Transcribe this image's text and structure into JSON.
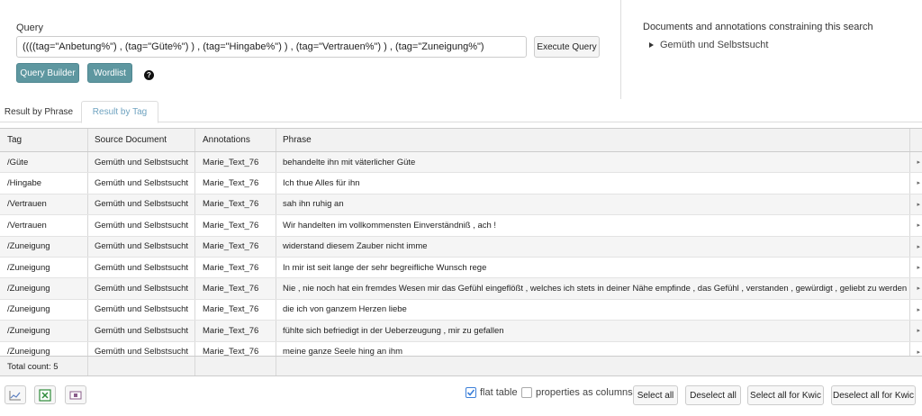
{
  "query": {
    "label": "Query",
    "value": "((((tag=\"Anbetung%\") , (tag=\"Güte%\") ) , (tag=\"Hingabe%\") ) , (tag=\"Vertrauen%\") ) , (tag=\"Zuneigung%\")",
    "execute_label": "Execute Query",
    "query_builder_label": "Query Builder",
    "wordlist_label": "Wordlist"
  },
  "constraints": {
    "title": "Documents and annotations constraining this search",
    "items": [
      "Gemüth und Selbstsucht"
    ]
  },
  "tabs": [
    {
      "label": "Result by Phrase",
      "active": false
    },
    {
      "label": "Result by Tag",
      "active": true
    }
  ],
  "table": {
    "columns": [
      "Tag",
      "Source Document",
      "Annotations",
      "Phrase"
    ],
    "rows": [
      {
        "tag": "/Güte",
        "source": "Gemüth und Selbstsucht",
        "annotations": "Marie_Text_76",
        "phrase": "behandelte ihn mit väterlicher Güte"
      },
      {
        "tag": "/Hingabe",
        "source": "Gemüth und Selbstsucht",
        "annotations": "Marie_Text_76",
        "phrase": "Ich thue Alles für ihn"
      },
      {
        "tag": "/Vertrauen",
        "source": "Gemüth und Selbstsucht",
        "annotations": "Marie_Text_76",
        "phrase": "sah ihn ruhig an"
      },
      {
        "tag": "/Vertrauen",
        "source": "Gemüth und Selbstsucht",
        "annotations": "Marie_Text_76",
        "phrase": "Wir handelten im vollkommensten Einverständniß , ach !"
      },
      {
        "tag": "/Zuneigung",
        "source": "Gemüth und Selbstsucht",
        "annotations": "Marie_Text_76",
        "phrase": "widerstand diesem Zauber nicht imme"
      },
      {
        "tag": "/Zuneigung",
        "source": "Gemüth und Selbstsucht",
        "annotations": "Marie_Text_76",
        "phrase": "In mir ist seit lange der sehr begreifliche Wunsch rege"
      },
      {
        "tag": "/Zuneigung",
        "source": "Gemüth und Selbstsucht",
        "annotations": "Marie_Text_76",
        "phrase": "Nie , nie noch hat ein fremdes Wesen mir das Gefühl eingeflößt , welches ich stets in deiner Nähe empfinde , das Gefühl , verstanden , gewürdigt , geliebt zu werden ."
      },
      {
        "tag": "/Zuneigung",
        "source": "Gemüth und Selbstsucht",
        "annotations": "Marie_Text_76",
        "phrase": "die ich von ganzem Herzen liebe"
      },
      {
        "tag": "/Zuneigung",
        "source": "Gemüth und Selbstsucht",
        "annotations": "Marie_Text_76",
        "phrase": "fühlte sich befriedigt in der Ueberzeugung , mir zu gefallen"
      },
      {
        "tag": "/Zuneigung",
        "source": "Gemüth und Selbstsucht",
        "annotations": "Marie_Text_76",
        "phrase": "meine ganze Seele hing an ihm"
      }
    ],
    "total_label": "Total count: 5"
  },
  "bottom": {
    "icons": [
      "chart-icon",
      "excel-icon",
      "kwic-icon"
    ],
    "flat_table_label": "flat table",
    "flat_table_checked": true,
    "properties_label": "properties as columns",
    "properties_checked": false,
    "select_all": "Select all",
    "deselect_all": "Deselect all",
    "select_all_kwic": "Select all for Kwic",
    "deselect_all_kwic": "Deselect all for Kwic"
  },
  "colors": {
    "accent": "#5e97a0",
    "active_tab": "#6fa3c0",
    "checkbox": "#3c7fd8"
  }
}
